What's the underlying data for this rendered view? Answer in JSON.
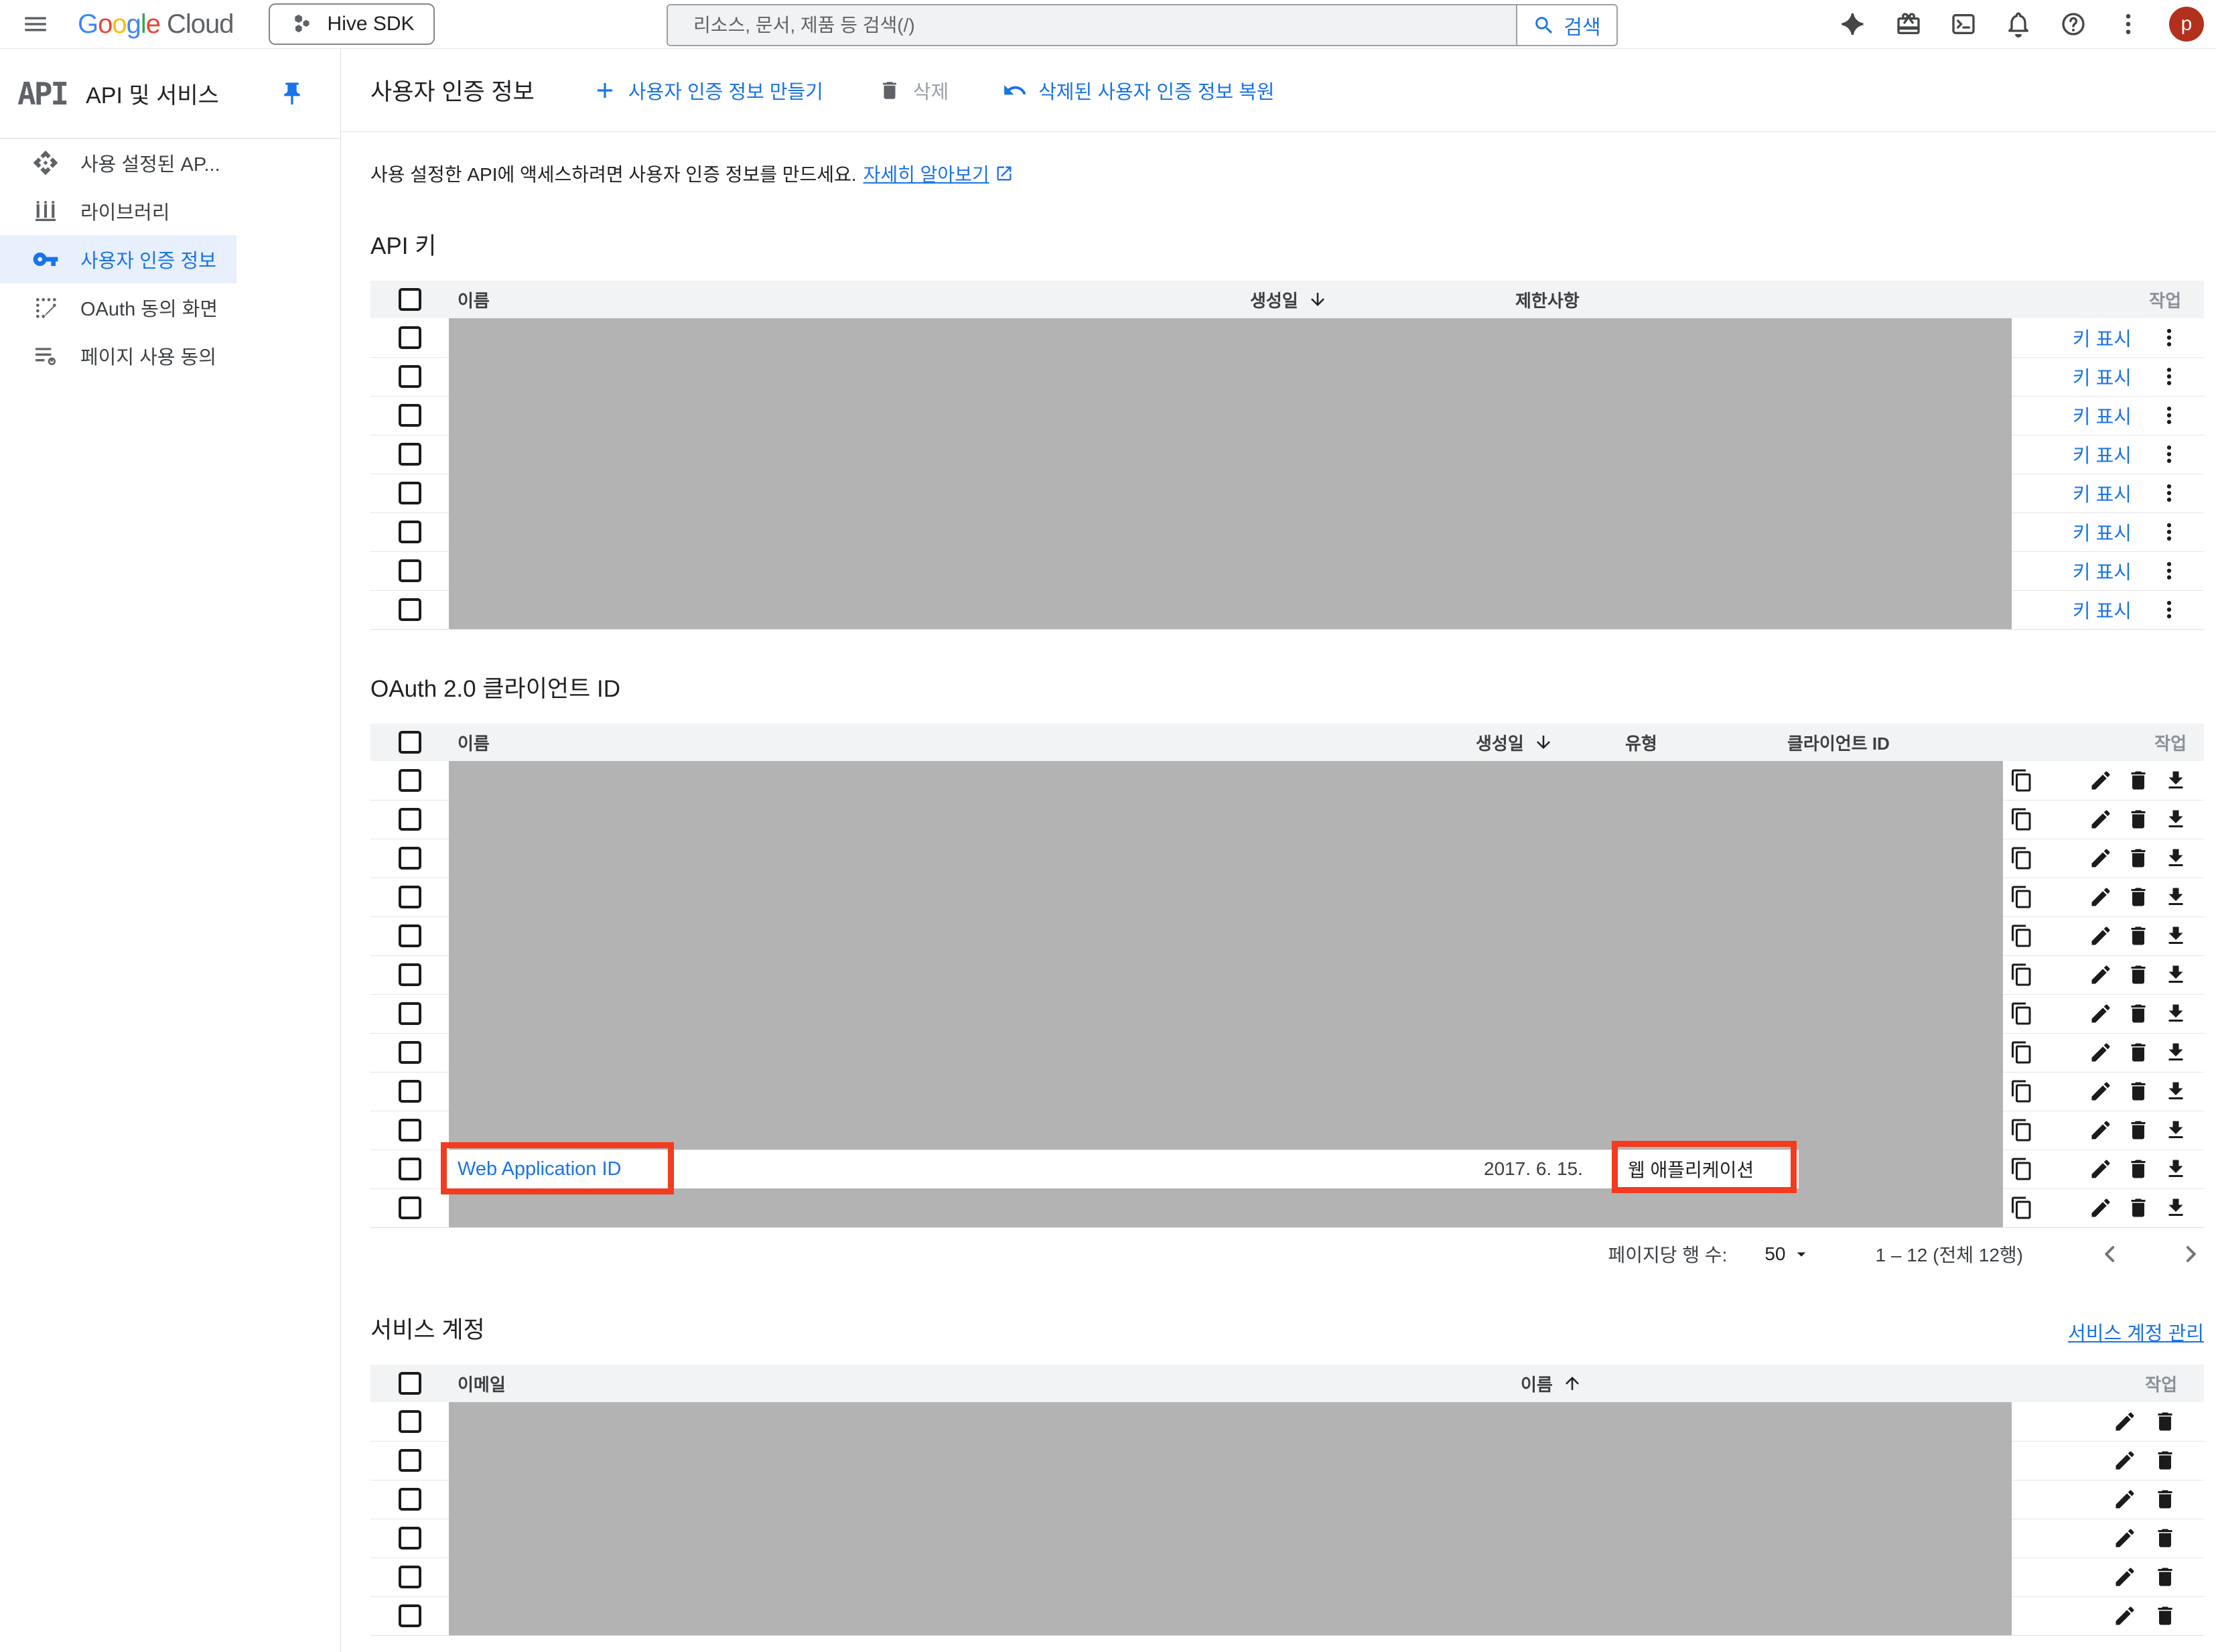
{
  "topbar": {
    "logo_letters": [
      "G",
      "o",
      "o",
      "g",
      "l",
      "e"
    ],
    "logo_cloud": "Cloud",
    "project_name": "Hive SDK",
    "search_placeholder": "리소스, 문서, 제품 등 검색(/)",
    "search_button": "검색",
    "avatar_letter": "p"
  },
  "sidebar": {
    "product_logo": "API",
    "title": "API 및 서비스",
    "items": [
      {
        "label": "사용 설정된 AP...",
        "icon": "enabled-apis-icon",
        "active": false
      },
      {
        "label": "라이브러리",
        "icon": "library-icon",
        "active": false
      },
      {
        "label": "사용자 인증 정보",
        "icon": "key-icon",
        "active": true
      },
      {
        "label": "OAuth 동의 화면",
        "icon": "oauth-consent-icon",
        "active": false
      },
      {
        "label": "페이지 사용 동의",
        "icon": "page-consent-icon",
        "active": false
      }
    ]
  },
  "header": {
    "title": "사용자 인증 정보",
    "create_button": "사용자 인증 정보 만들기",
    "delete_button": "삭제",
    "restore_button": "삭제된 사용자 인증 정보 복원"
  },
  "intro": {
    "text": "사용 설정한 API에 액세스하려면 사용자 인증 정보를 만드세요.",
    "learn_more": "자세히 알아보기"
  },
  "api_keys": {
    "section_title": "API 키",
    "headers": {
      "name": "이름",
      "created": "생성일",
      "restrictions": "제한사항",
      "actions": "작업"
    },
    "show_key_label": "키 표시",
    "rows": [
      {
        "redacted": true
      },
      {
        "redacted": true
      },
      {
        "redacted": true
      },
      {
        "redacted": true
      },
      {
        "redacted": true
      },
      {
        "redacted": true
      },
      {
        "redacted": true
      },
      {
        "redacted": true
      }
    ]
  },
  "oauth": {
    "section_title": "OAuth 2.0 클라이언트 ID",
    "headers": {
      "name": "이름",
      "created": "생성일",
      "type": "유형",
      "client_id": "클라이언트 ID",
      "actions": "작업"
    },
    "rows": [
      {
        "redacted": true
      },
      {
        "redacted": true
      },
      {
        "redacted": true
      },
      {
        "redacted": true
      },
      {
        "redacted": true
      },
      {
        "redacted": true
      },
      {
        "redacted": true
      },
      {
        "redacted": true
      },
      {
        "redacted": true
      },
      {
        "redacted": true
      },
      {
        "redacted": false,
        "highlighted": true,
        "name": "Web Application ID",
        "created": "2017. 6. 15.",
        "type": "웹 애플리케이션",
        "client_id_redacted": true
      },
      {
        "redacted": true
      }
    ]
  },
  "pagination": {
    "rows_per_page_label": "페이지당 행 수:",
    "rows_per_page": "50",
    "range": "1 – 12 (전체 12행)"
  },
  "service_accounts": {
    "section_title": "서비스 계정",
    "manage_link": "서비스 계정 관리",
    "headers": {
      "email": "이메일",
      "name": "이름",
      "actions": "작업"
    },
    "rows": [
      {
        "redacted": true
      },
      {
        "redacted": true
      },
      {
        "redacted": true
      },
      {
        "redacted": true
      },
      {
        "redacted": true
      },
      {
        "redacted": true
      }
    ]
  },
  "colors": {
    "accent_blue": "#1a73e8",
    "redaction_gray": "#b3b3b3",
    "highlight_red": "#f23b1f",
    "avatar_red": "#b3301d",
    "google_letter_colors": [
      "#4285F4",
      "#EA4335",
      "#FBBC05",
      "#4285F4",
      "#34A853",
      "#EA4335"
    ]
  }
}
